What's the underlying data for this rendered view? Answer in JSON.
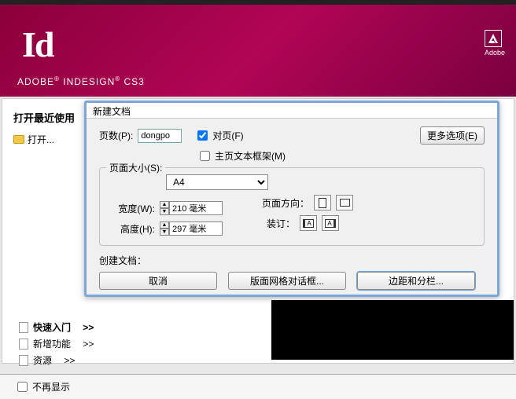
{
  "window": {
    "close": "×"
  },
  "header": {
    "logo": "Id",
    "product_pre": "ADOBE",
    "product_mid": " INDESIGN",
    "product_suf": " CS3",
    "brand": "Adobe"
  },
  "sidebar": {
    "title": "打开最近使用",
    "open": "打开..."
  },
  "dialog": {
    "title": "新建文档",
    "pages_label": "页数(P):",
    "pages_value": "dongpo",
    "facing_label": "对页(F)",
    "master_frame_label": "主页文本框架(M)",
    "more_options": "更多选项(E)",
    "size_legend": "页面大小(S):",
    "size_value": "A4",
    "width_label": "宽度(W):",
    "width_value": "210 毫米",
    "height_label": "高度(H):",
    "height_value": "297 毫米",
    "orientation_label": "页面方向：",
    "binding_label": "装订：",
    "create_label": "创建文档：",
    "cancel": "取消",
    "layout_grid": "版面网格对话框...",
    "margins": "边距和分栏...",
    "bind_char": "A"
  },
  "bottom": {
    "quickstart": "快速入门",
    "newfeatures": "新增功能",
    "resources": "资源",
    "arrows": ">>"
  },
  "footer": {
    "dont_show": "不再显示"
  }
}
